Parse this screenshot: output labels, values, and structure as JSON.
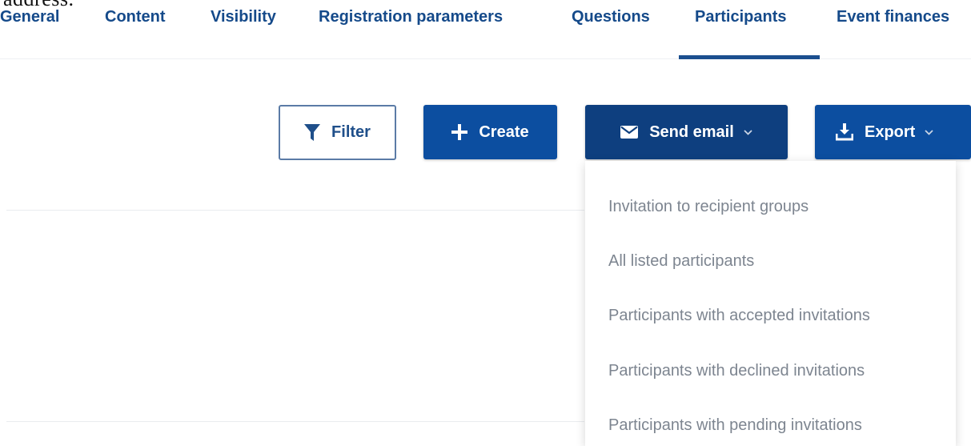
{
  "document": {
    "clipped_text": "address."
  },
  "tabs": [
    {
      "label": "General"
    },
    {
      "label": "Content"
    },
    {
      "label": "Visibility"
    },
    {
      "label": "Registration parameters"
    },
    {
      "label": "Questions"
    },
    {
      "label": "Participants",
      "active": true
    },
    {
      "label": "Event finances"
    }
  ],
  "toolbar": {
    "filter_label": "Filter",
    "create_label": "Create",
    "send_email_label": "Send email",
    "export_label": "Export"
  },
  "send_email_menu": {
    "items": [
      {
        "label": "Invitation to recipient groups"
      },
      {
        "label": "All listed participants"
      },
      {
        "label": "Participants with accepted invitations"
      },
      {
        "label": "Participants with declined invitations"
      },
      {
        "label": "Participants with pending invitations"
      }
    ]
  },
  "colors": {
    "tab_text": "#154a8a",
    "primary_button": "#0c4ea0",
    "send_email_button": "#0e3f7f",
    "menu_text": "#7d8590"
  },
  "icons": [
    "filter-icon",
    "plus-icon",
    "envelope-icon",
    "chevron-down-icon",
    "download-icon"
  ]
}
